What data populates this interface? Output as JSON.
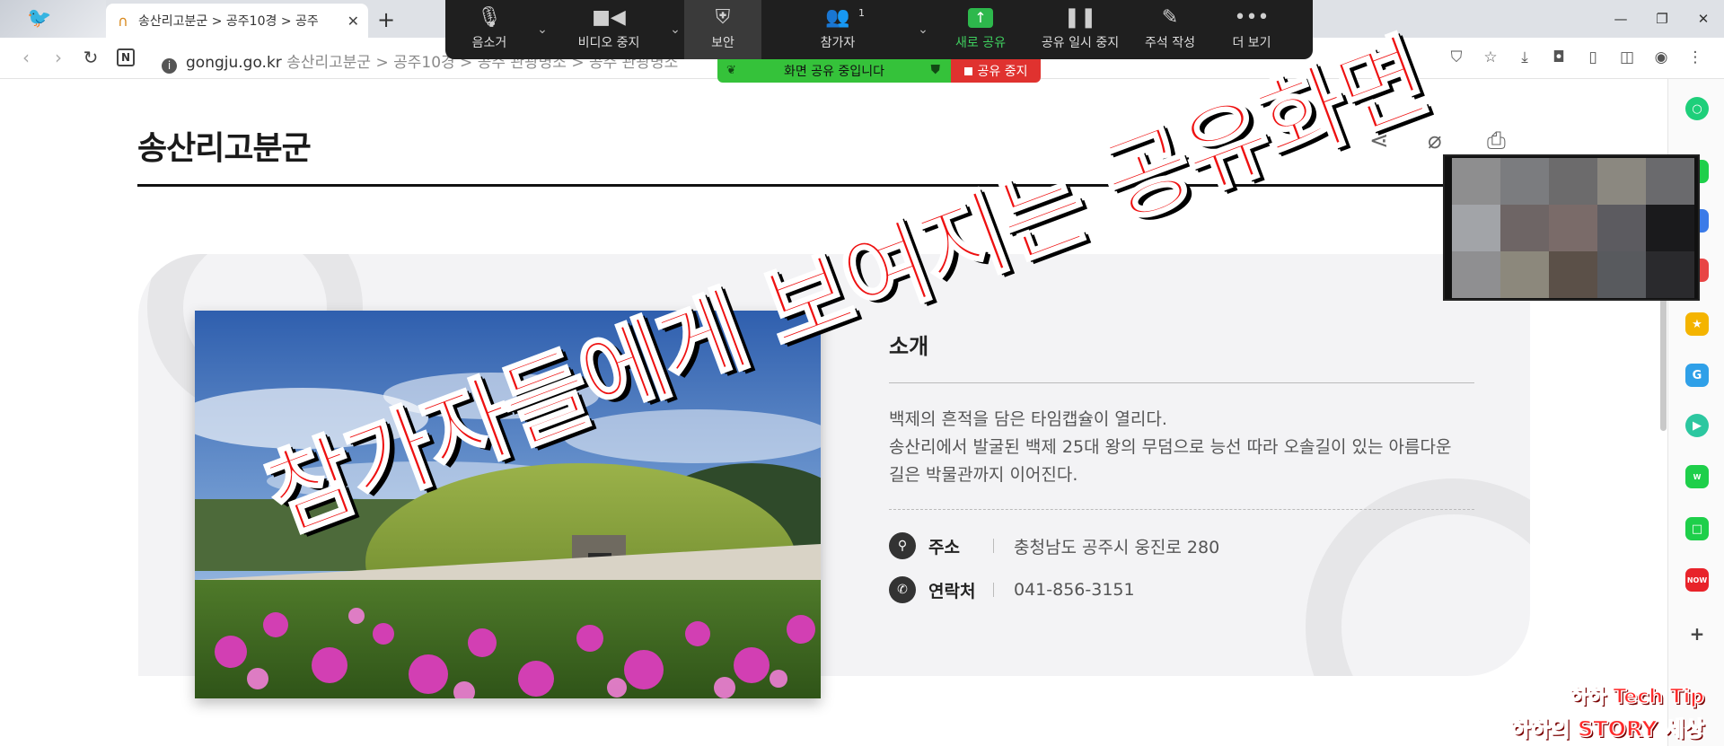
{
  "browser": {
    "tab_title": "송산리고분군 > 공주10경 > 공주",
    "url_domain": "gongju.go.kr",
    "url_path": " 송산리고분군 > 공주10경 > 공주 관광명소 > 공주 관광명소"
  },
  "zoom": {
    "mute_label": "음소거",
    "video_label": "비디오 중지",
    "security_label": "보안",
    "participants_label": "참가자",
    "participants_count": "1",
    "new_share_label": "새로 공유",
    "pause_share_label": "공유 일시 중지",
    "annotate_label": "주석 작성",
    "more_label": "더 보기",
    "sharing_banner": "화면 공유 중입니다",
    "stop_share_label": "공유 중지",
    "accent": "#35c23a",
    "stop_color": "#e0322f"
  },
  "page": {
    "title": "송산리고분군",
    "section_heading": "소개",
    "desc_line1": "백제의 흔적을 담은 타임캡슐이 열리다.",
    "desc_line2": "송산리에서 발굴된 백제 25대 왕의 무덤으로 능선 따라 오솔길이 있는 아름다운",
    "desc_line3": "길은 박물관까지 이어진다.",
    "address_label": "주소",
    "address_value": "충청남도 공주시 웅진로 280",
    "phone_label": "연락처",
    "phone_value": "041-856-3151"
  },
  "overlay": {
    "caption": "참가자들에게 보여지는 공유화면"
  },
  "watermark": {
    "line1": "하하 Tech Tip",
    "line2": "하하의 STORY 세상"
  },
  "sidebar_icons": [
    "circle-icon",
    "chat-icon",
    "calendar-icon",
    "mail-icon",
    "star-icon",
    "translate-icon",
    "play-icon",
    "webtoon-icon",
    "square-icon",
    "now-icon",
    "plus-icon"
  ]
}
